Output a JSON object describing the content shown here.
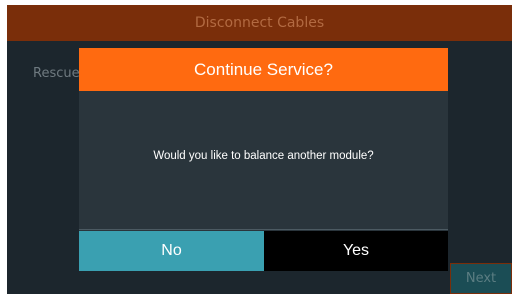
{
  "header": {
    "title": "Disconnect Cables",
    "background_color": "#7a2e0a"
  },
  "background": {
    "text": "Rescue"
  },
  "footer": {
    "next_label": "Next"
  },
  "dialog": {
    "title": "Continue Service?",
    "message": "Would you like to balance another module?",
    "no_label": "No",
    "yes_label": "Yes",
    "title_color": "#ff6a10",
    "no_color": "#3aa0b1",
    "yes_color": "#000000"
  }
}
